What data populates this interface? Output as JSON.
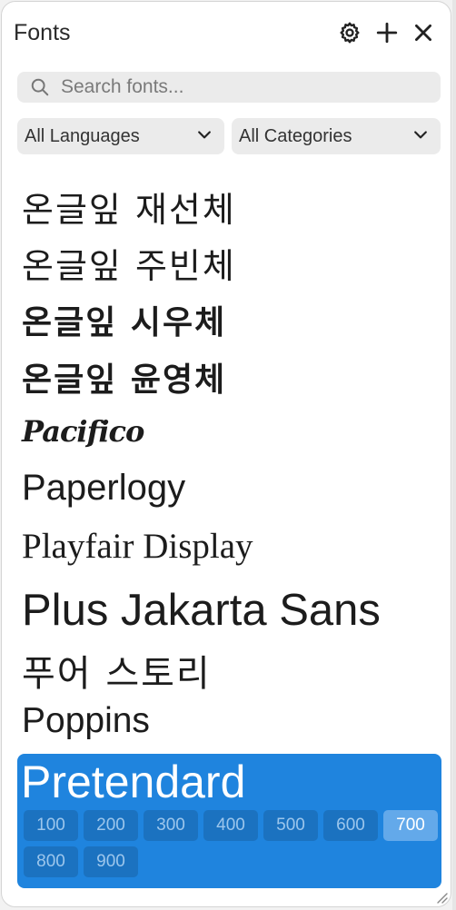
{
  "panel": {
    "title": "Fonts",
    "icons": {
      "settings": "gear-icon",
      "add": "plus-icon",
      "close": "close-icon"
    }
  },
  "search": {
    "placeholder": "Search fonts...",
    "value": ""
  },
  "filters": {
    "language": "All Languages",
    "category": "All Categories"
  },
  "fonts": [
    "온글잎 재선체",
    "온글잎 주빈체",
    "온글잎 시우체",
    "온글잎 윤영체",
    "Pacifico",
    "Paperlogy",
    "Playfair Display",
    "Plus Jakarta Sans",
    "푸어 스토리",
    "Poppins"
  ],
  "selected_font": {
    "name": "Pretendard",
    "weights": [
      "100",
      "200",
      "300",
      "400",
      "500",
      "600",
      "700",
      "800",
      "900"
    ],
    "active_weight": "700"
  },
  "colors": {
    "selected_bg": "#1f84de",
    "weight_bg": "#1b72c0",
    "weight_active_bg": "#63a9ea"
  }
}
